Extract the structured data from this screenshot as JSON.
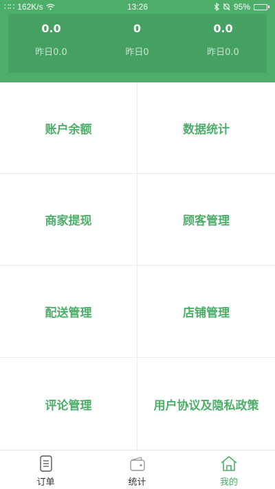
{
  "status_bar": {
    "signal_text": "∷∷",
    "speed": "162K/s",
    "time": "13:26",
    "battery": "95%",
    "battery_level": 0.95
  },
  "stats": [
    {
      "value": "0.0",
      "yesterday": "昨日0.0"
    },
    {
      "value": "0",
      "yesterday": "昨日0"
    },
    {
      "value": "0.0",
      "yesterday": "昨日0.0"
    }
  ],
  "grid": [
    "账户余额",
    "数据统计",
    "商家提现",
    "顾客管理",
    "配送管理",
    "店铺管理",
    "评论管理",
    "用户协议及隐私政策"
  ],
  "tabs": [
    {
      "label": "订单",
      "icon": "document-icon",
      "active": false
    },
    {
      "label": "统计",
      "icon": "wallet-icon",
      "active": false
    },
    {
      "label": "我的",
      "icon": "home-icon",
      "active": true
    }
  ],
  "colors": {
    "primary": "#4dae6a",
    "card": "#45a062",
    "divider": "#ededed"
  }
}
